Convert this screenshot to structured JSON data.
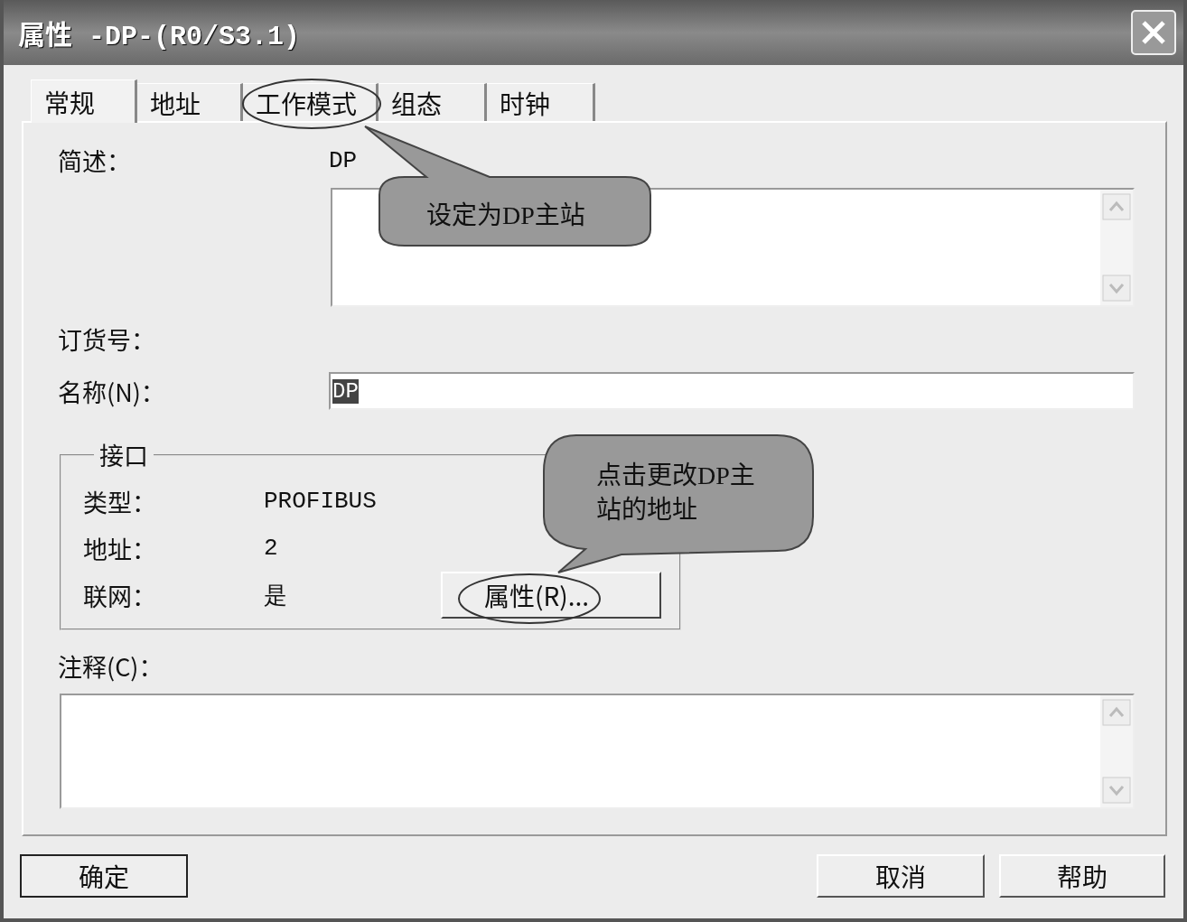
{
  "window": {
    "title": "属性 -DP-(R0/S3.1)"
  },
  "tabs": [
    {
      "label": "常规",
      "selected": true
    },
    {
      "label": "地址",
      "selected": false
    },
    {
      "label": "工作模式",
      "selected": false
    },
    {
      "label": "组态",
      "selected": false
    },
    {
      "label": "时钟",
      "selected": false
    }
  ],
  "general": {
    "short_description": {
      "label": "简述：",
      "value": "DP"
    },
    "order_number": {
      "label": "订货号："
    },
    "name": {
      "label": "名称(N)：",
      "value": "DP"
    },
    "interface": {
      "title": "接口",
      "rows": [
        {
          "label": "类型：",
          "value": "PROFIBUS"
        },
        {
          "label": "地址：",
          "value": "2"
        },
        {
          "label": "联网：",
          "value": "是"
        }
      ],
      "properties_button": "属性(R)..."
    },
    "comment": {
      "label": "注释(C)："
    }
  },
  "buttons": {
    "ok": "确定",
    "cancel": "取消",
    "help": "帮助"
  },
  "callouts": [
    {
      "text": "设定为DP主站"
    },
    {
      "text": "点击更改DP主站的地址"
    }
  ]
}
